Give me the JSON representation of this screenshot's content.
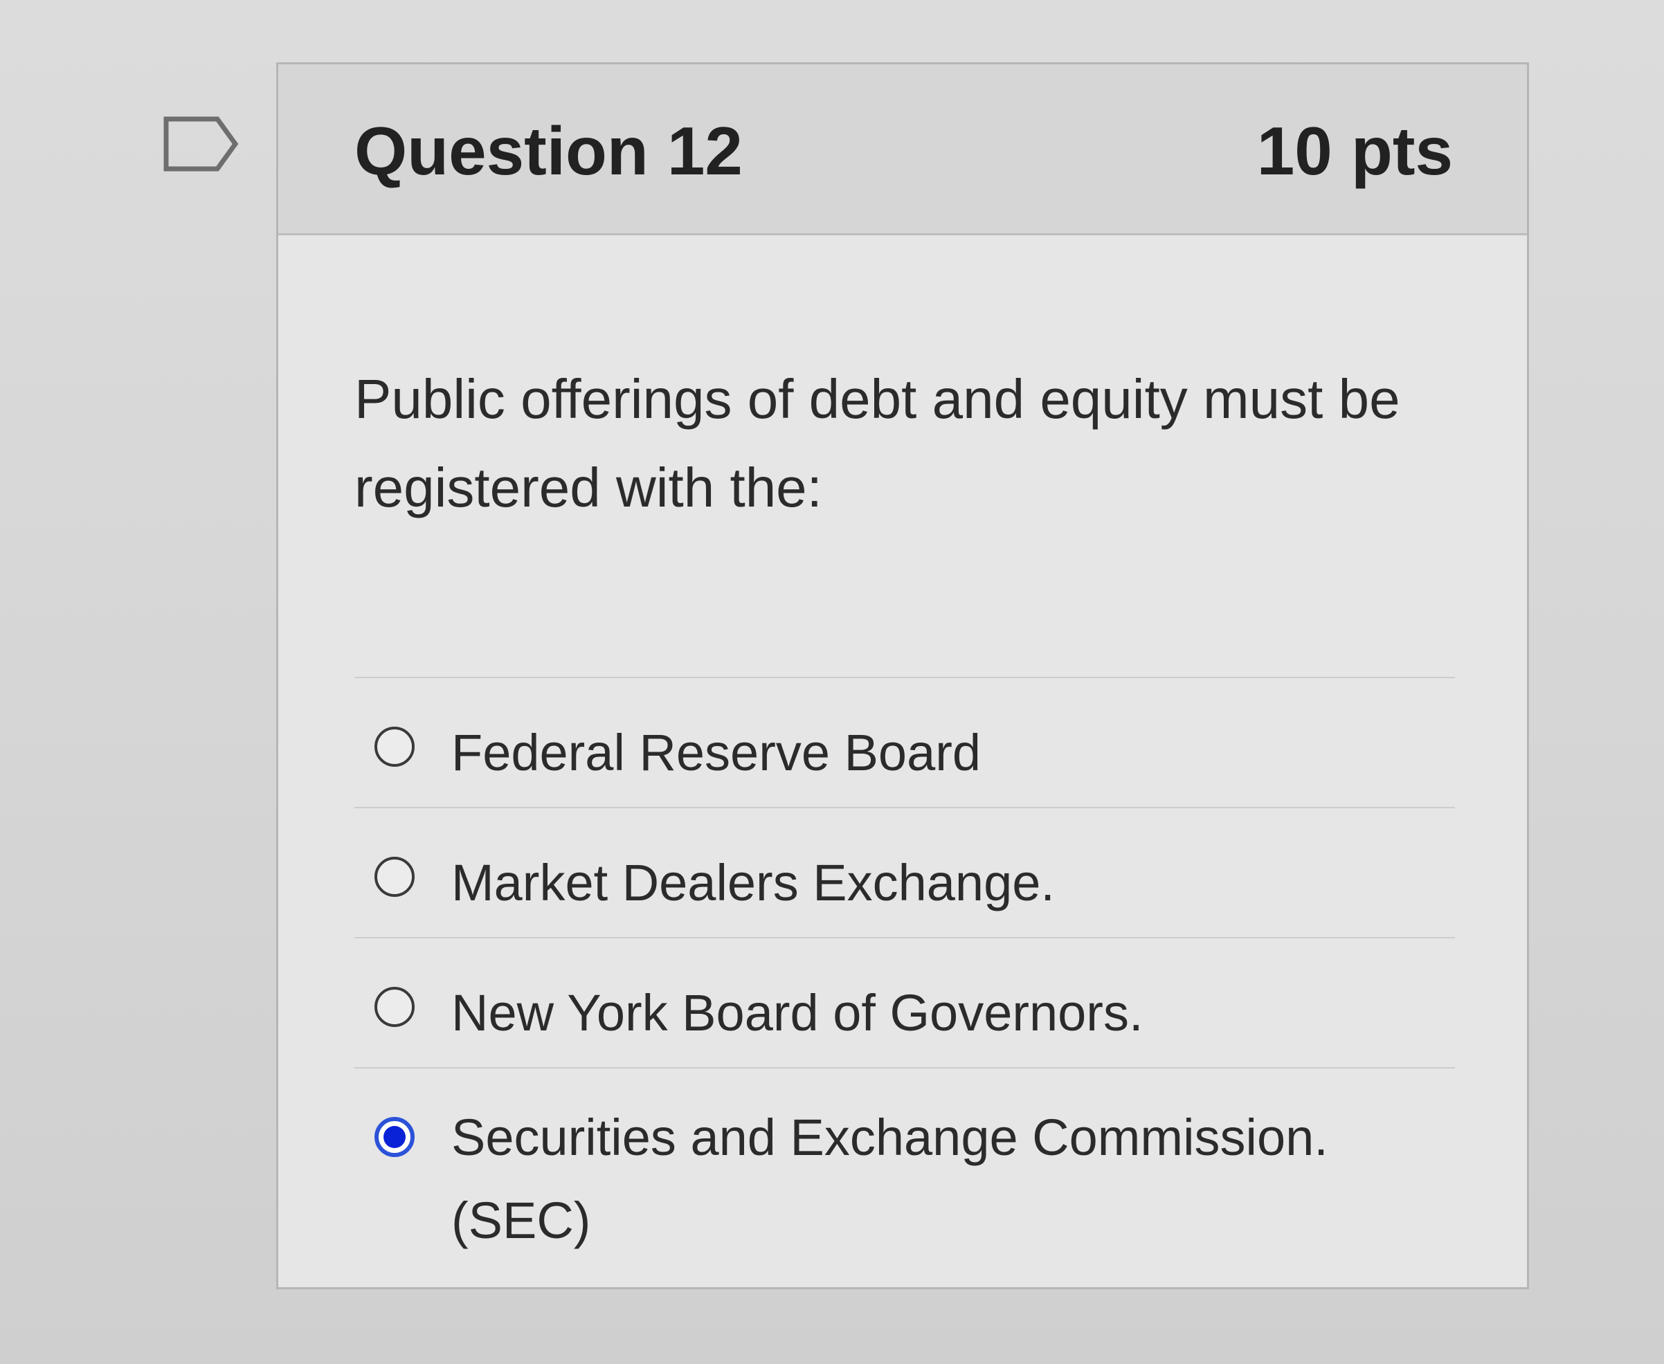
{
  "question": {
    "flag_icon": "flag-icon",
    "title": "Question 12",
    "points": "10 pts",
    "text": "Public offerings of debt and equity must be registered with the:",
    "answers": [
      {
        "label": "Federal Reserve Board",
        "selected": false
      },
      {
        "label": "Market Dealers Exchange.",
        "selected": false
      },
      {
        "label": "New York Board of Governors.",
        "selected": false
      },
      {
        "label": "Securities and Exchange Commission. (SEC)",
        "selected": true
      }
    ]
  },
  "colors": {
    "selected_radio": "#0a22d6",
    "header_background": "#d6d6d6",
    "card_background": "#e6e6e6"
  }
}
